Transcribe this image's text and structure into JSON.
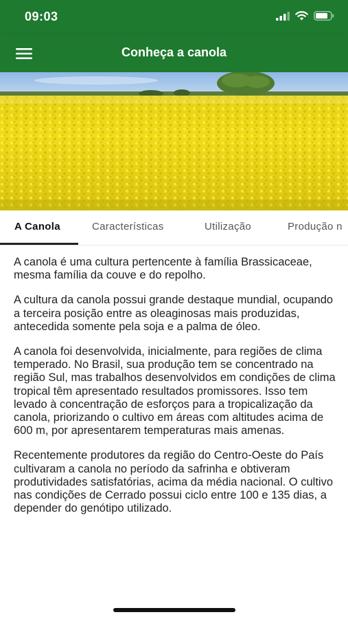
{
  "status_bar": {
    "time": "09:03",
    "icons": [
      "signal-icon",
      "wifi-icon",
      "battery-icon"
    ]
  },
  "app_bar": {
    "menu_icon": "hamburger-menu-icon",
    "title": "Conheça a canola",
    "background_color": "#1e7a2e"
  },
  "hero_image": {
    "subject": "canola field in bloom with tree and blue sky"
  },
  "tabs": [
    {
      "label": "A Canola",
      "active": true
    },
    {
      "label": "Características",
      "active": false
    },
    {
      "label": "Utilização",
      "active": false
    },
    {
      "label": "Produção n",
      "active": false
    }
  ],
  "content": {
    "paragraphs": [
      "A canola é uma cultura pertencente à família Brassicaceae, mesma família da couve e do repolho.",
      "A cultura da canola possui grande destaque mundial, ocupando a terceira posição entre as oleaginosas mais produzidas, antecedida somente pela soja e a palma de óleo.",
      "A canola foi desenvolvida, inicialmente, para regiões de clima temperado. No Brasil, sua produção tem se concentrado na região Sul, mas trabalhos desenvolvidos em condições de clima tropical têm apresentado resultados promissores. Isso tem levado à concentração de esforços para a tropicalização da canola, priorizando o cultivo em áreas com altitudes acima de 600 m, por apresentarem temperaturas mais amenas.",
      "Recentemente produtores da região do Centro-Oeste do País cultivaram a canola no período da safrinha e obtiveram produtividades satisfatórias, acima da média nacional. O cultivo nas condições de Cerrado possui ciclo entre 100 e 135 dias, a depender do genótipo utilizado."
    ]
  }
}
